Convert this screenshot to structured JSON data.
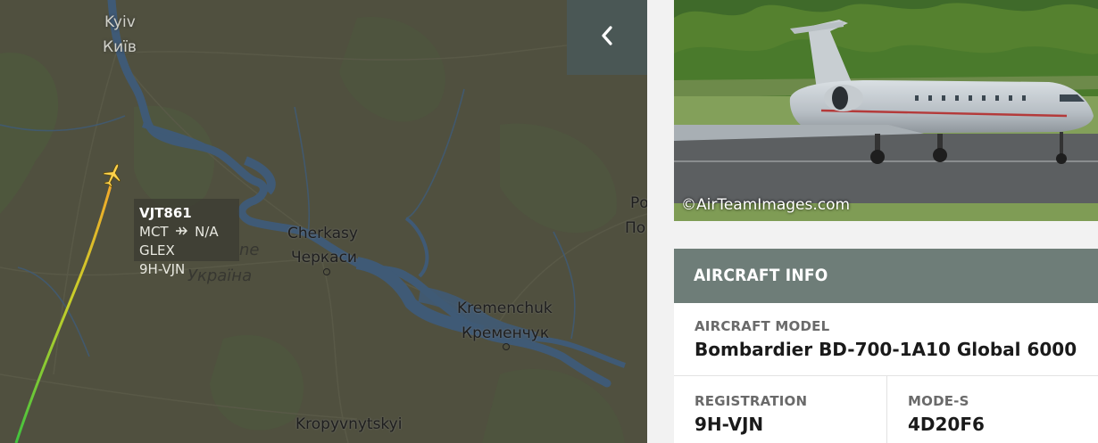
{
  "map": {
    "cities": {
      "kyiv_en": "Kyiv",
      "kyiv_uk": "Київ",
      "cherkasy_en": "Cherkasy",
      "cherkasy_uk": "Черкаси",
      "kremenchuk_en": "Kremenchuk",
      "kremenchuk_uk": "Кременчук",
      "kropyvnytskyi_en": "Kropyvnytskyi",
      "ukraine_partial": "ne",
      "ukraine_uk": "Україна",
      "edge_1": "Ро",
      "edge_2": "По"
    },
    "flight": {
      "callsign": "VJT861",
      "origin": "MCT",
      "destination": "N/A",
      "aircraft_code": "GLEX",
      "registration": "9H-VJN"
    },
    "colors": {
      "water": "#3f5a76",
      "land": "#50503f",
      "trail_start": "#3ec33e",
      "trail_end": "#f2a92a"
    }
  },
  "panel": {
    "photo_credit": "©AirTeamImages.com",
    "info_header": "AIRCRAFT INFO",
    "model_label": "AIRCRAFT MODEL",
    "model_value": "Bombardier BD-700-1A10 Global 6000",
    "registration_label": "REGISTRATION",
    "registration_value": "9H-VJN",
    "modes_label": "MODE-S",
    "modes_value": "4D20F6"
  },
  "icons": [
    "airplane-icon",
    "chevron-left-icon",
    "arrow-plane-icon"
  ]
}
